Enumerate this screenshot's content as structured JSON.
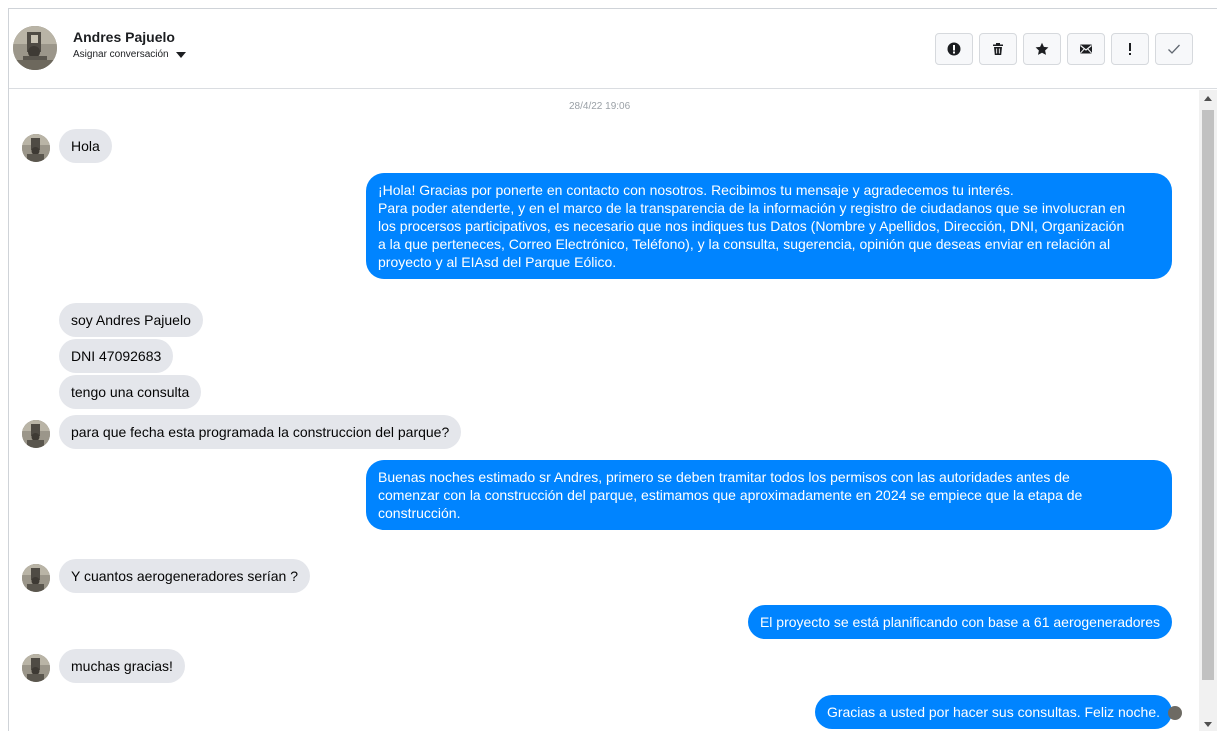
{
  "header": {
    "name": "Andres Pajuelo",
    "assign_label": "Asignar conversación"
  },
  "toolbar": {
    "buttons": [
      {
        "icon": "alert-circle-icon"
      },
      {
        "icon": "trash-icon"
      },
      {
        "icon": "star-icon"
      },
      {
        "icon": "envelope-icon"
      },
      {
        "icon": "exclamation-icon"
      },
      {
        "icon": "check-icon"
      }
    ]
  },
  "conversation": {
    "timestamp": "28/4/22 19:06",
    "messages": [
      {
        "from": "user",
        "text": "Hola"
      },
      {
        "from": "page",
        "lines": [
          "¡Hola! Gracias por ponerte en contacto con nosotros. Recibimos tu mensaje y agradecemos tu interés.",
          "Para poder atenderte, y en el marco de la transparencia de la información y registro de ciudadanos que se involucran en",
          "los procersos participativos, es necesario que nos indiques tus Datos (Nombre y Apellidos, Dirección, DNI, Organización",
          "a la que perteneces, Correo Electrónico, Teléfono), y la consulta, sugerencia, opinión que deseas enviar en relación al",
          "proyecto y al EIAsd del Parque Eólico."
        ]
      },
      {
        "from": "user",
        "text": "soy Andres Pajuelo"
      },
      {
        "from": "user",
        "text": "DNI 47092683"
      },
      {
        "from": "user",
        "text": "tengo una consulta"
      },
      {
        "from": "user",
        "text": "para que fecha esta programada la construccion del parque?"
      },
      {
        "from": "page",
        "lines": [
          "Buenas noches estimado sr Andres, primero se deben tramitar todos los permisos con las autoridades antes de",
          "comenzar con la construcción del parque, estimamos que aproximadamente en 2024 se empiece que la etapa de",
          "construcción."
        ]
      },
      {
        "from": "user",
        "text": "Y cuantos aerogeneradores serían ?"
      },
      {
        "from": "page",
        "text": "El proyecto se está planificando con base a 61 aerogeneradores"
      },
      {
        "from": "user",
        "text": "muchas gracias!"
      },
      {
        "from": "page",
        "text": "Gracias a usted por hacer sus consultas. Feliz noche."
      }
    ]
  },
  "colors": {
    "outgoing_bubble": "#0084ff",
    "incoming_bubble": "#e4e6eb"
  }
}
